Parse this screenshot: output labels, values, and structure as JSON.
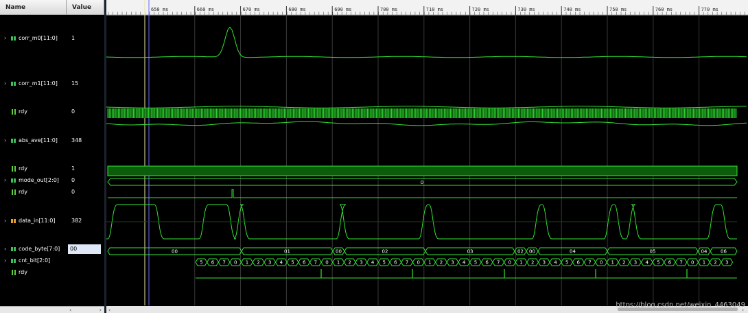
{
  "headers": {
    "name": "Name",
    "value": "Value"
  },
  "colors": {
    "wave": "#33e633",
    "grid": "#3a3a3a",
    "cursor_yellow": "#e8e8a0",
    "cursor_blue": "#6a6aff",
    "bus_fill": "#0b5d0b"
  },
  "time_axis": {
    "unit": "ms",
    "ticks": [
      "650 ms",
      "660 ms",
      "670 ms",
      "680 ms",
      "690 ms",
      "700 ms",
      "710 ms",
      "720 ms",
      "730 ms",
      "740 ms",
      "750 ms",
      "760 ms",
      "770 ms"
    ]
  },
  "signals": [
    {
      "name": "corr_m0[11:0]",
      "value": "1",
      "expandable": true,
      "type": "bus-analog"
    },
    {
      "name": "corr_m1[11:0]",
      "value": "15",
      "expandable": true,
      "type": "bus-analog"
    },
    {
      "name": "rdy",
      "value": "0",
      "expandable": false,
      "type": "bit"
    },
    {
      "name": "abs_ave[11:0]",
      "value": "348",
      "expandable": true,
      "type": "bus-analog"
    },
    {
      "name": "rdy",
      "value": "1",
      "expandable": false,
      "type": "bit"
    },
    {
      "name": "mode_out[2:0]",
      "value": "0",
      "expandable": true,
      "type": "bus"
    },
    {
      "name": "rdy",
      "value": "0",
      "expandable": false,
      "type": "bit"
    },
    {
      "name": "data_in[11:0]",
      "value": "382",
      "expandable": true,
      "type": "bus-analog"
    },
    {
      "name": "code_byte[7:0]",
      "value": "00",
      "expandable": true,
      "type": "bus",
      "selected": true
    },
    {
      "name": "cnt_bit[2:0]",
      "value": "",
      "expandable": true,
      "type": "bus"
    },
    {
      "name": "rdy",
      "value": "",
      "expandable": false,
      "type": "bit"
    }
  ],
  "mode_out_label": "0",
  "code_byte_labels": [
    "00",
    "01",
    "00",
    "02",
    "03",
    "02",
    "00",
    "04",
    "05",
    "04",
    "06"
  ],
  "cnt_bit_labels": [
    "5",
    "6",
    "7",
    "0",
    "1",
    "2",
    "3",
    "4",
    "5",
    "6",
    "7",
    "0",
    "1",
    "2",
    "3",
    "4",
    "5",
    "6",
    "7",
    "0",
    "1",
    "2",
    "3",
    "4",
    "5",
    "6",
    "7",
    "0",
    "1",
    "2",
    "3",
    "4",
    "5",
    "6",
    "7",
    "0",
    "1",
    "2",
    "3",
    "4",
    "5",
    "6",
    "7",
    "0",
    "1",
    "2",
    "3"
  ],
  "watermark": "https://blog.csdn.net/weixin_4463049"
}
